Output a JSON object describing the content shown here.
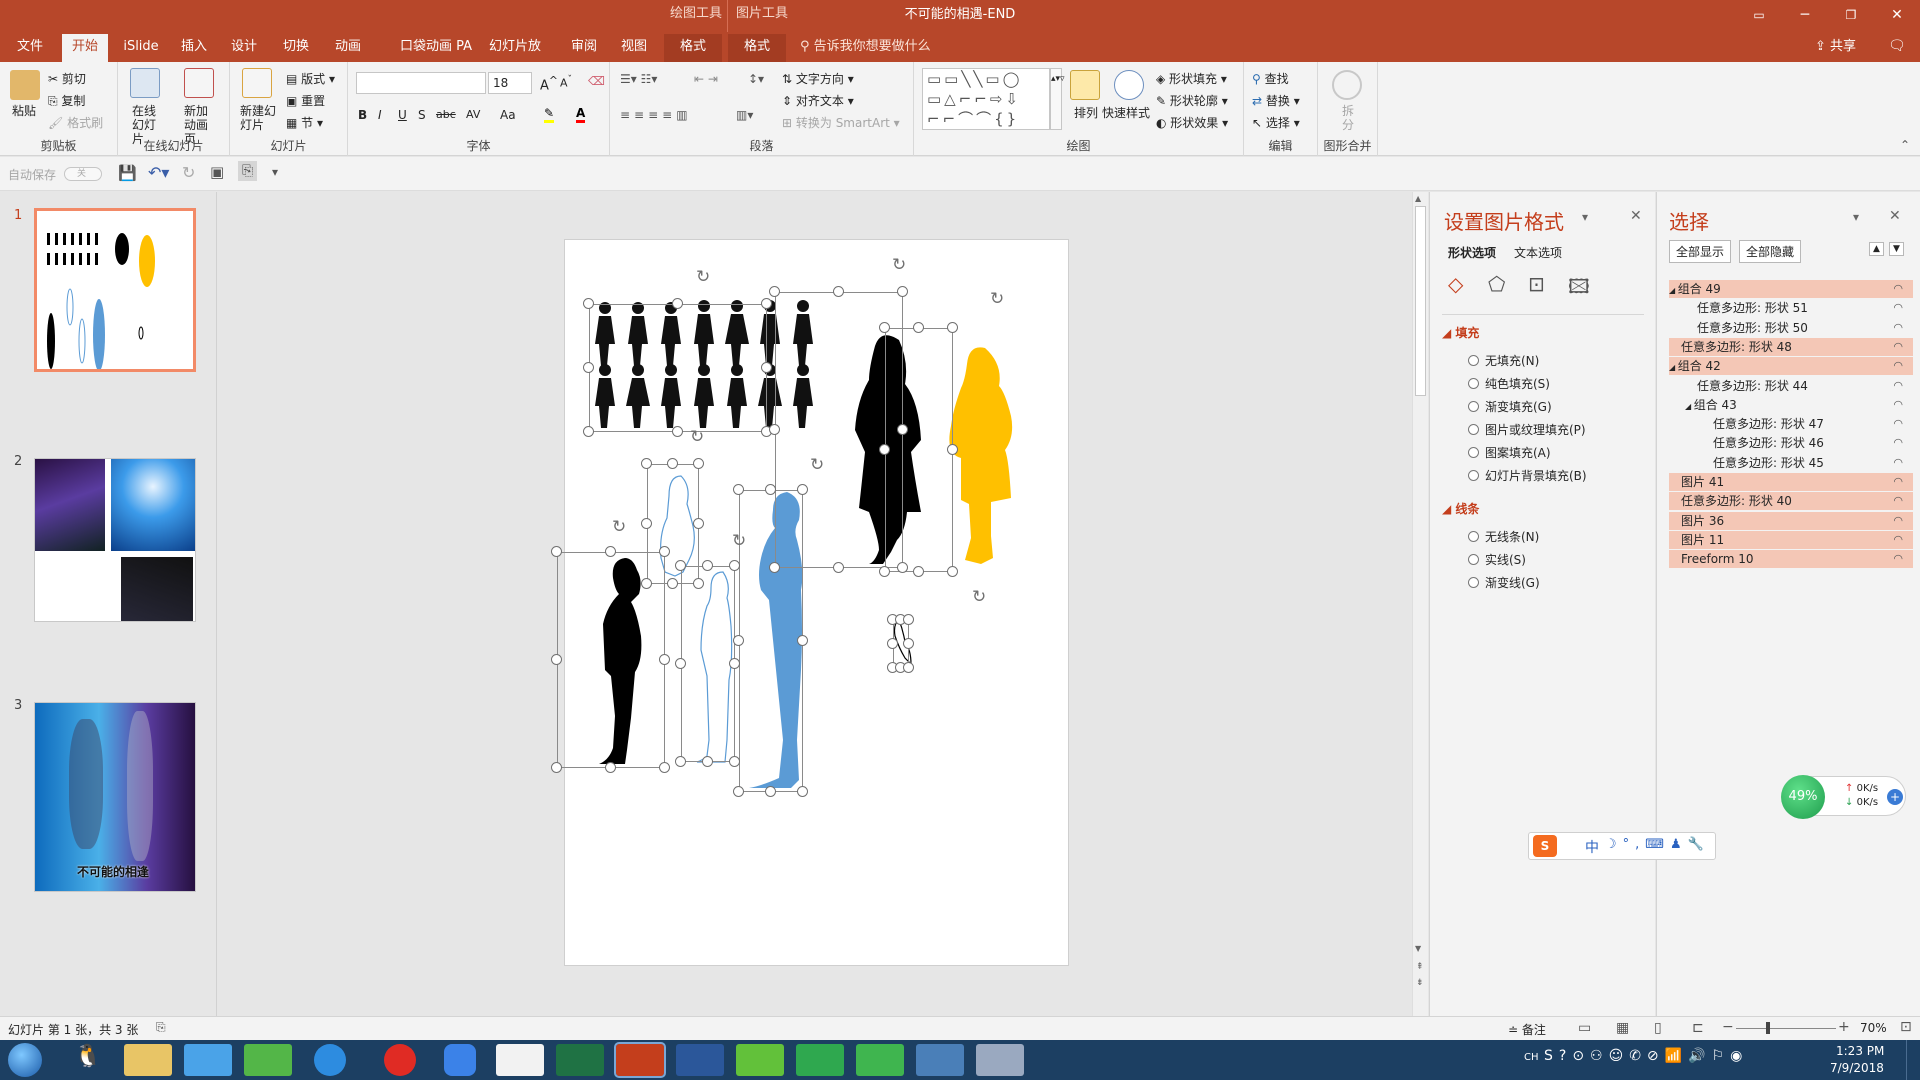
{
  "window": {
    "title": "不可能的相遇-END",
    "context_groups": [
      "绘图工具",
      "图片工具"
    ]
  },
  "tabs": [
    "文件",
    "开始",
    "iSlide",
    "插入",
    "设计",
    "切换",
    "动画",
    "口袋动画 PA",
    "幻灯片放映",
    "审阅",
    "视图",
    "格式",
    "格式"
  ],
  "tell_me": "告诉我你想要做什么",
  "share": "共享",
  "ribbon": {
    "clipboard": {
      "label": "剪贴板",
      "paste": "粘贴",
      "cut": "剪切",
      "copy": "复制",
      "format_painter": "格式刷"
    },
    "online": {
      "label": "在线幻灯片",
      "online_slides": "在线幻灯片",
      "new_animation": "新加动画页"
    },
    "slides": {
      "label": "幻灯片",
      "new_slide": "新建幻灯片",
      "layout": "版式",
      "reset": "重置",
      "section": "节"
    },
    "font": {
      "label": "字体",
      "font_size": "18",
      "bold": "B",
      "italic": "I",
      "underline": "U",
      "shadow": "S",
      "strike": "abc",
      "spacing": "AV",
      "case": "Aa"
    },
    "paragraph": {
      "label": "段落",
      "text_direction": "文字方向",
      "align_text": "对齐文本",
      "smartart": "转换为 SmartArt"
    },
    "drawing": {
      "label": "绘图",
      "arrange": "排列",
      "quick_styles": "快速样式",
      "shape_fill": "形状填充",
      "shape_outline": "形状轮廓",
      "shape_effects": "形状效果"
    },
    "editing": {
      "label": "编辑",
      "find": "查找",
      "replace": "替换",
      "select": "选择"
    },
    "merge": {
      "label": "图形合并",
      "split": "拆分"
    }
  },
  "qat": {
    "autosave": "自动保存",
    "autosave_state": "关"
  },
  "thumbnails": [
    {
      "num": "1"
    },
    {
      "num": "2"
    },
    {
      "num": "3",
      "caption": "不可能的相逢"
    }
  ],
  "format_pane": {
    "title": "设置图片格式",
    "tabs": [
      "形状选项",
      "文本选项"
    ],
    "fill_section": "填充",
    "fill_options": [
      "无填充(N)",
      "纯色填充(S)",
      "渐变填充(G)",
      "图片或纹理填充(P)",
      "图案填充(A)",
      "幻灯片背景填充(B)"
    ],
    "line_section": "线条",
    "line_options": [
      "无线条(N)",
      "实线(S)",
      "渐变线(G)"
    ]
  },
  "selection_pane": {
    "title": "选择",
    "show_all": "全部显示",
    "hide_all": "全部隐藏",
    "items": [
      {
        "label": "组合 49",
        "indent": 0,
        "expand": true,
        "hl": true
      },
      {
        "label": "任意多边形: 形状 51",
        "indent": 1,
        "expand": false,
        "hl": false
      },
      {
        "label": "任意多边形: 形状 50",
        "indent": 1,
        "expand": false,
        "hl": false
      },
      {
        "label": "任意多边形: 形状 48",
        "indent": 0,
        "expand": false,
        "hl": true
      },
      {
        "label": "组合 42",
        "indent": 0,
        "expand": true,
        "hl": true
      },
      {
        "label": "任意多边形: 形状 44",
        "indent": 1,
        "expand": false,
        "hl": false
      },
      {
        "label": "组合 43",
        "indent": 1,
        "expand": true,
        "hl": false
      },
      {
        "label": "任意多边形: 形状 47",
        "indent": 2,
        "expand": false,
        "hl": false
      },
      {
        "label": "任意多边形: 形状 46",
        "indent": 2,
        "expand": false,
        "hl": false
      },
      {
        "label": "任意多边形: 形状 45",
        "indent": 2,
        "expand": false,
        "hl": false
      },
      {
        "label": "图片 41",
        "indent": 0,
        "expand": false,
        "hl": true
      },
      {
        "label": "任意多边形: 形状 40",
        "indent": 0,
        "expand": false,
        "hl": true
      },
      {
        "label": "图片 36",
        "indent": 0,
        "expand": false,
        "hl": true
      },
      {
        "label": "图片 11",
        "indent": 0,
        "expand": false,
        "hl": true
      },
      {
        "label": "Freeform 10",
        "indent": 0,
        "expand": false,
        "hl": true
      }
    ]
  },
  "status": {
    "slide_info": "幻灯片 第 1 张，共 3 张",
    "notes": "备注",
    "zoom": "70%"
  },
  "net_widget": {
    "percent": "49%",
    "up": "0K/s",
    "down": "0K/s"
  },
  "ime": {
    "mode": "中"
  },
  "clock": {
    "time": "1:23 PM",
    "date": "7/9/2018"
  },
  "tray_lang": "CH",
  "colors": {
    "accent": "#b7472a",
    "yellow": "#ffc000",
    "blue": "#5b9bd5",
    "selection": "#f4c7b6"
  }
}
